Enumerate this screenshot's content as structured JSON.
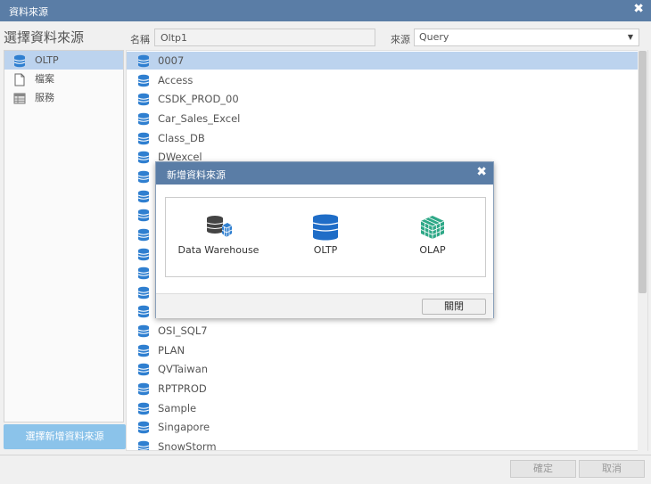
{
  "window": {
    "title": "資料來源"
  },
  "heading": "選擇資料來源",
  "form": {
    "name_label": "名稱",
    "name_value": "Oltp1",
    "source_label": "來源",
    "source_value": "Query"
  },
  "left_panel": {
    "items": [
      {
        "label": "OLTP",
        "icon": "database-icon",
        "selected": true
      },
      {
        "label": "檔案",
        "icon": "file-icon",
        "selected": false
      },
      {
        "label": "服務",
        "icon": "service-icon",
        "selected": false
      }
    ],
    "add_button_label": "選擇新增資料來源"
  },
  "data_sources": [
    {
      "name": "0007",
      "selected": true
    },
    {
      "name": "Access"
    },
    {
      "name": "CSDK_PROD_00"
    },
    {
      "name": "Car_Sales_Excel"
    },
    {
      "name": "Class_DB"
    },
    {
      "name": "DWexcel"
    },
    {
      "name": ""
    },
    {
      "name": ""
    },
    {
      "name": ""
    },
    {
      "name": ""
    },
    {
      "name": ""
    },
    {
      "name": ""
    },
    {
      "name": ""
    },
    {
      "name": ""
    },
    {
      "name": "OSI_SQL7"
    },
    {
      "name": "PLAN"
    },
    {
      "name": "QVTaiwan"
    },
    {
      "name": "RPTPROD"
    },
    {
      "name": "Sample"
    },
    {
      "name": "Singapore"
    },
    {
      "name": "SnowStorm"
    }
  ],
  "footer": {
    "ok_label": "確定",
    "cancel_label": "取消"
  },
  "overlay": {
    "title": "新增資料來源",
    "options": [
      {
        "label": "Data Warehouse",
        "icon": "data-warehouse-icon"
      },
      {
        "label": "OLTP",
        "icon": "database-icon"
      },
      {
        "label": "OLAP",
        "icon": "cube-icon"
      }
    ],
    "close_label": "關閉"
  },
  "colors": {
    "titlebar": "#5a7da6",
    "selection": "#bcd3ee",
    "accent_button": "#8bc3ea",
    "db_icon": "#2f7fd0"
  }
}
